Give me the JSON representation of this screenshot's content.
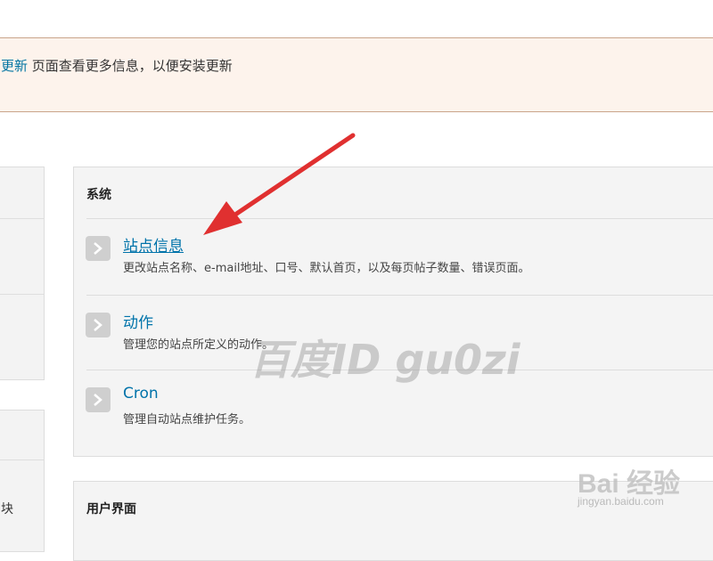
{
  "notice": {
    "link_text": "更新",
    "text": " 页面查看更多信息，以便安装更新"
  },
  "left_panel": {
    "text": "块"
  },
  "system_panel": {
    "title": "系统",
    "items": [
      {
        "title": "站点信息",
        "description": "更改站点名称、e-mail地址、口号、默认首页，以及每页帖子数量、错误页面。",
        "icon": "chevron-right-icon"
      },
      {
        "title": "动作",
        "description": "管理您的站点所定义的动作。",
        "icon": "chevron-right-icon"
      },
      {
        "title": "Cron",
        "description": "管理自动站点维护任务。",
        "icon": "chevron-right-icon"
      }
    ]
  },
  "ui_panel": {
    "title": "用户界面"
  },
  "watermark": {
    "text": "百度ID gu0zi"
  },
  "logo": {
    "text": "Bai 经验",
    "sub": "jingyan.baidu.com"
  },
  "colors": {
    "link": "#0073aa",
    "arrow": "#e03030",
    "notice_bg": "#fdf3ec"
  }
}
